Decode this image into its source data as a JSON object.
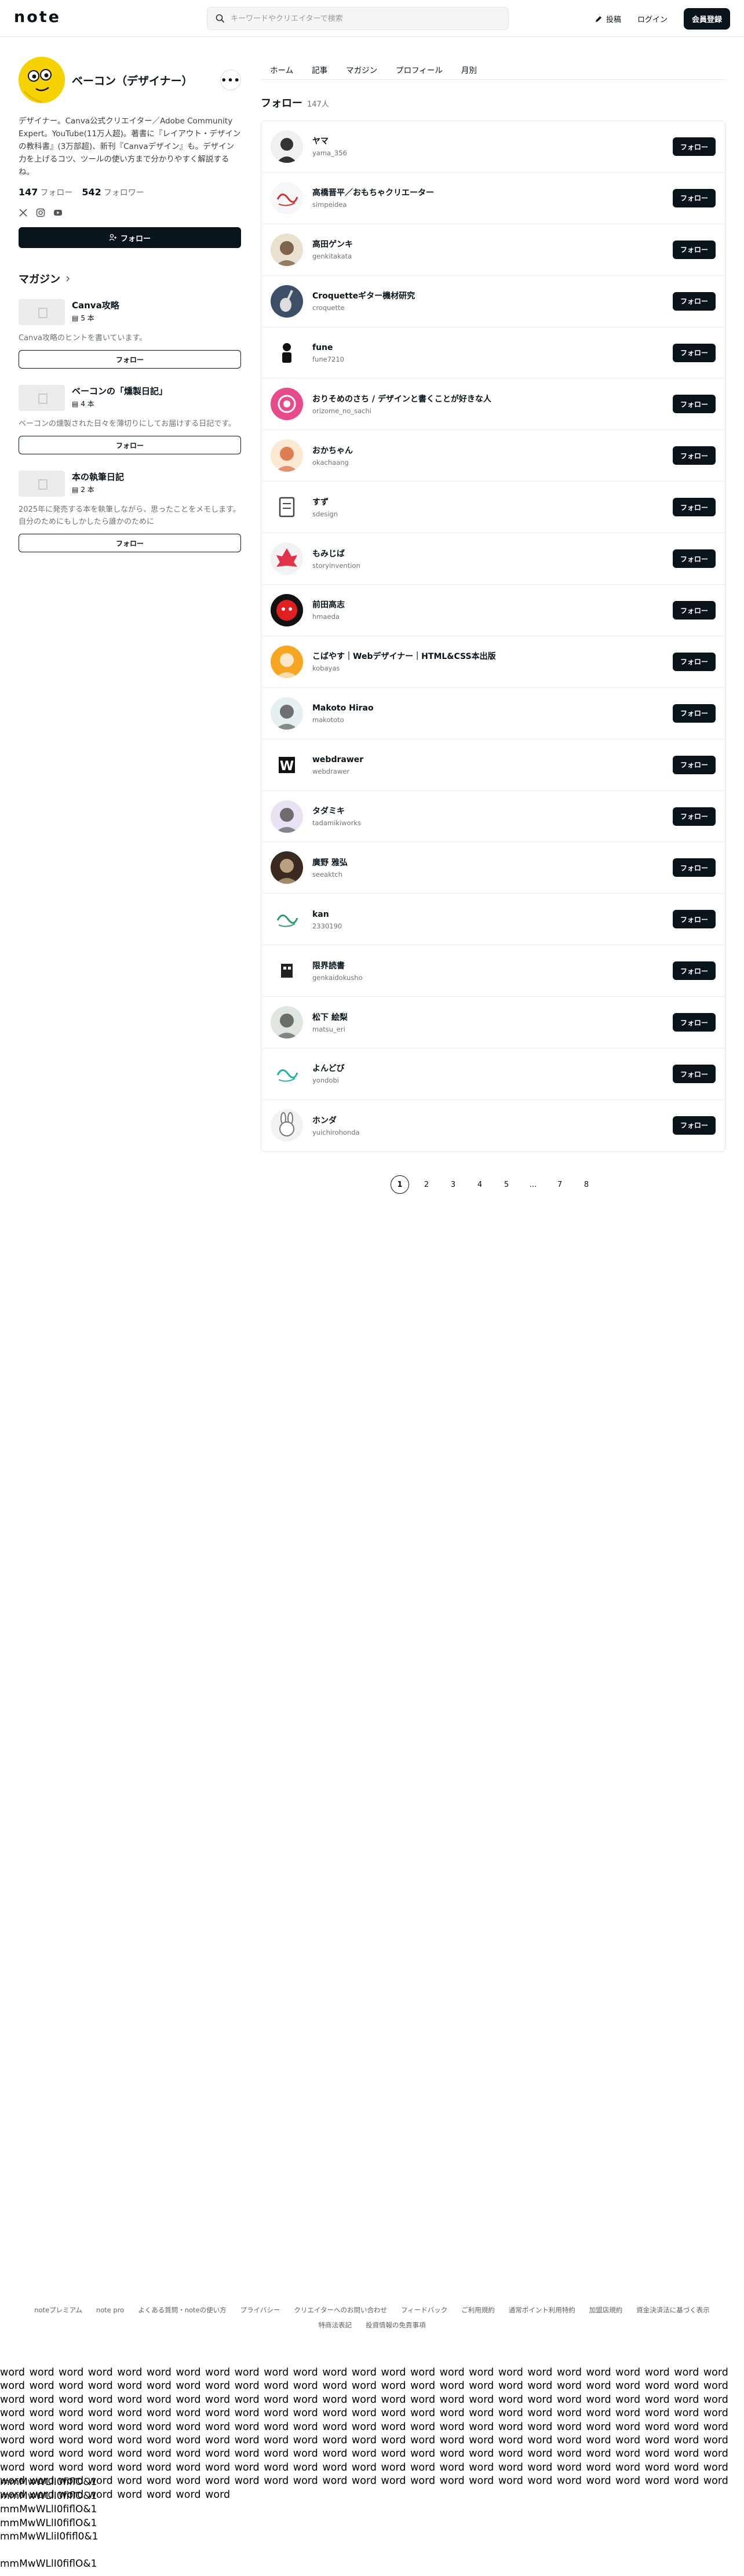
{
  "header": {
    "logo": "note",
    "search_placeholder": "キーワードやクリエイターで検索",
    "post_label": "投稿",
    "login_label": "ログイン",
    "signup_label": "会員登録"
  },
  "profile": {
    "name": "ベーコン（デザイナー）",
    "bio": "デザイナー。Canva公式クリエイター／Adobe Community Expert。YouTube(11万人超)。著書に『レイアウト・デザインの教科書』(3万部超)、新刊『Canvaデザイン』も。デザイン力を上げるコツ、ツールの使い方まで分かりやすく解説するね。",
    "following_count": "147",
    "following_label": "フォロー",
    "followers_count": "542",
    "followers_label": "フォロワー",
    "follow_button": "フォロー"
  },
  "magazine": {
    "title": "マガジン",
    "items": [
      {
        "name": "Canva攻略",
        "count": "5 本",
        "desc": "Canva攻略のヒントを書いています。",
        "follow": "フォロー"
      },
      {
        "name": "ベーコンの「燻製日記」",
        "count": "4 本",
        "desc": "ベーコンの燻製された日々を薄切りにしてお届けする日記です。",
        "follow": "フォロー"
      },
      {
        "name": "本の執筆日記",
        "count": "2 本",
        "desc": "2025年に発売する本を執筆しながら、思ったことをメモします。自分のためにもしかしたら誰かのために",
        "follow": "フォロー"
      }
    ]
  },
  "tabs": [
    "ホーム",
    "記事",
    "マガジン",
    "プロフィール",
    "月別"
  ],
  "following_section": {
    "title": "フォロー",
    "count": "147人",
    "follow_label": "フォロー",
    "users": [
      {
        "name": "ヤマ",
        "id": "yama_356"
      },
      {
        "name": "高橋晋平／おもちゃクリエーター",
        "id": "simpeidea"
      },
      {
        "name": "高田ゲンキ",
        "id": "genkitakata"
      },
      {
        "name": "Croquetteギター機材研究",
        "id": "croquette"
      },
      {
        "name": "fune",
        "id": "fune7210"
      },
      {
        "name": "おりそめのさち / デザインと書くことが好きな人",
        "id": "orizome_no_sachi"
      },
      {
        "name": "おかちゃん",
        "id": "okachaang"
      },
      {
        "name": "すず",
        "id": "sdesign"
      },
      {
        "name": "もみじば",
        "id": "storyinvention"
      },
      {
        "name": "前田高志",
        "id": "hmaeda"
      },
      {
        "name": "こばやす｜Webデザイナー｜HTML&CSS本出版",
        "id": "kobayas"
      },
      {
        "name": "Makoto Hirao",
        "id": "makototo"
      },
      {
        "name": "webdrawer",
        "id": "webdrawer"
      },
      {
        "name": "タダミキ",
        "id": "tadamikiworks"
      },
      {
        "name": "廣野 雅弘",
        "id": "seeaktch"
      },
      {
        "name": "kan",
        "id": "2330190"
      },
      {
        "name": "限界読書",
        "id": "genkaidokusho"
      },
      {
        "name": "松下 絵梨",
        "id": "matsu_eri"
      },
      {
        "name": "よんどび",
        "id": "yondobi"
      },
      {
        "name": "ホンダ",
        "id": "yuichirohonda"
      }
    ]
  },
  "pagination": [
    "1",
    "2",
    "3",
    "4",
    "5",
    "…",
    "7",
    "8"
  ],
  "footer": {
    "links": [
      "noteプレミアム",
      "note pro",
      "よくある質問・noteの使い方",
      "プライバシー",
      "クリエイターへのお問い合わせ",
      "フィードバック",
      "ご利用規約",
      "通常ポイント利用特約",
      "加盟店規約",
      "資金決済法に基づく表示",
      "特商法表記",
      "投資情報の免責事項"
    ]
  },
  "test_text": {
    "words": "word word word word word word word word word word word word word word word word word word word word word word word word word word word word word word word word word word word word word word word word word word word word word word word word word word word word word word word word word word word word word word word word word word word word word word word word word word word word word word word word word word word word word word word word word word word word word word word word word word word word word word word word word word word word word word word word word word word word word word word word word word word word word word word word word word word word word word word word word word word word word word word word word word word word word word word word word word word word word word word word word word word word word word word word word word word word word word word word word word word word word word word word word word word word word word word word word word word word word word word word word word word word word word word word word word word word word word word word word word word word word word word word word word word word word word word word word",
    "glyph_lines": [
      "mmMwWLlI0fiflO&1",
      "mmMwWLlI0fiflO&1",
      "mmMwWLlI0fiflO&1",
      "mmMwWLlI0fiflO&1",
      "mmMwWLliI0fifl0&1",
      "",
      "mmMwWLlI0fiflO&1"
    ]
  }
}
